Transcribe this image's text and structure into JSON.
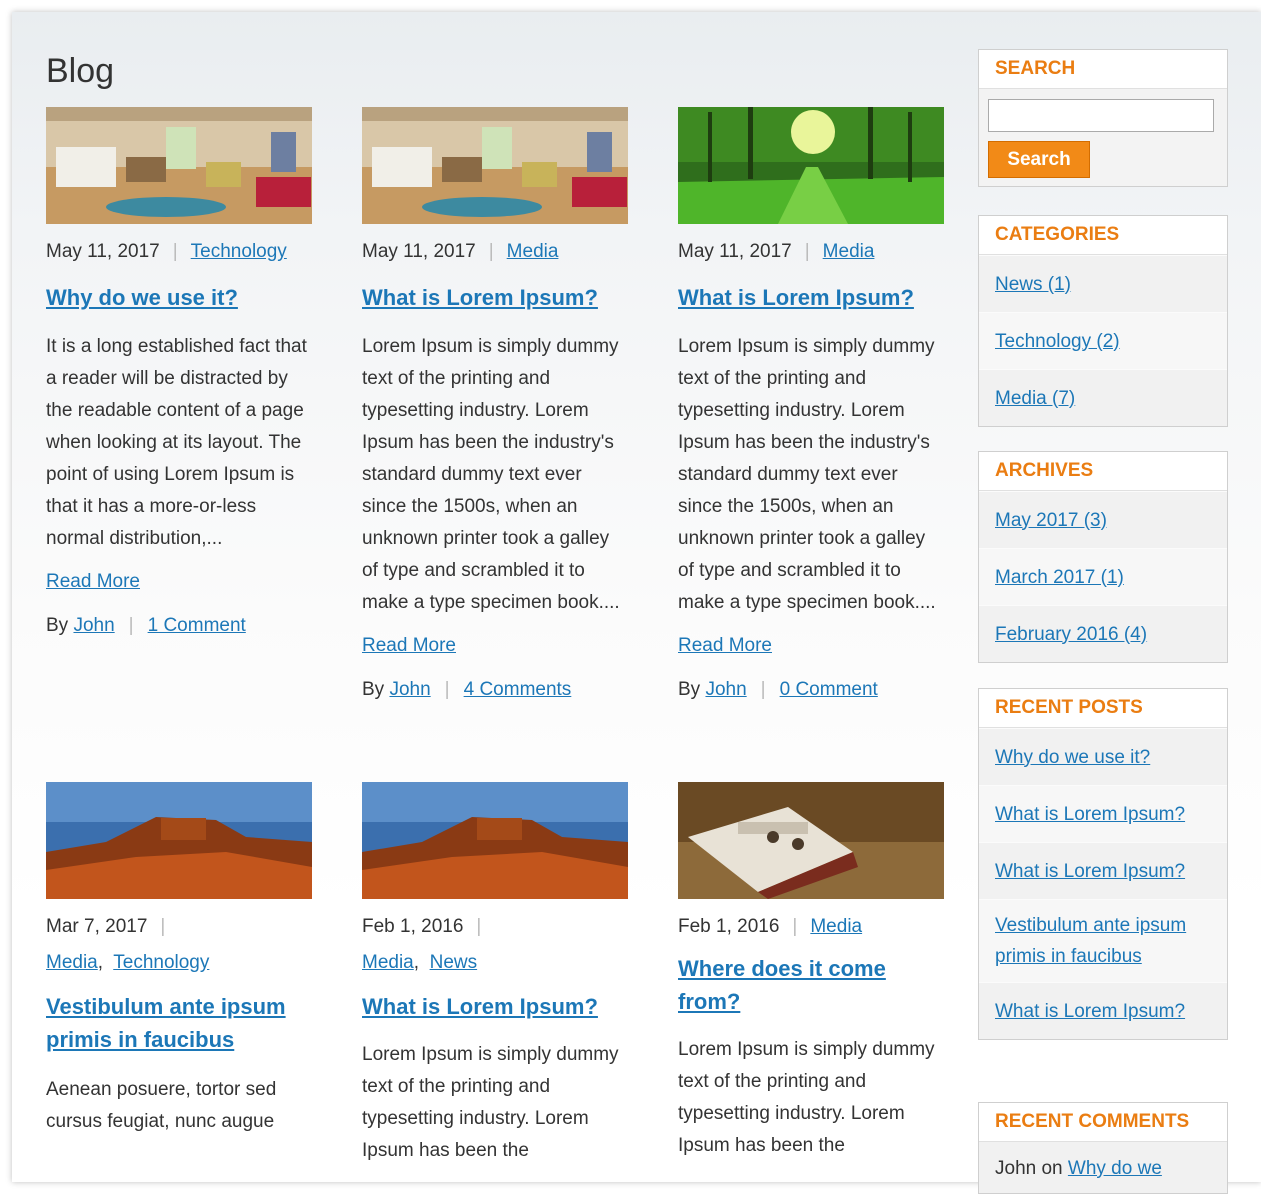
{
  "blog": {
    "title": "Blog",
    "posts": [
      {
        "date": "May 11, 2017",
        "category": "Technology",
        "title": "Why do we use it?",
        "excerpt": "It is a long established fact that a reader will be distracted by the readable content of a page when looking at its layout. The point of using Lorem Ipsum is that it has a more-or-less normal distribution,...",
        "read_more": "Read More",
        "by": "By",
        "author": "John",
        "comments": "1 Comment"
      },
      {
        "date": "May 11, 2017",
        "category": "Media",
        "title": "What is Lorem Ipsum?",
        "excerpt": "Lorem Ipsum is simply dummy text of the printing and typesetting industry. Lorem Ipsum has been the industry's standard dummy text ever since the 1500s, when an unknown printer took a galley of type and scrambled it to make a type specimen book....",
        "read_more": "Read More",
        "by": "By",
        "author": "John",
        "comments": "4 Comments"
      },
      {
        "date": "May 11, 2017",
        "category": "Media",
        "title": "What is Lorem Ipsum?",
        "excerpt": "Lorem Ipsum is simply dummy text of the printing and typesetting industry. Lorem Ipsum has been the industry's standard dummy text ever since the 1500s, when an unknown printer took a galley of type and scrambled it to make a type specimen book....",
        "read_more": "Read More",
        "by": "By",
        "author": "John",
        "comments": "0 Comment"
      },
      {
        "date": "Mar 7, 2017",
        "cat1": "Media",
        "cat2": "Technology",
        "title": "Vestibulum ante ipsum primis in faucibus",
        "excerpt": "Aenean posuere, tortor sed cursus feugiat, nunc augue"
      },
      {
        "date": "Feb 1, 2016",
        "cat1": "Media",
        "cat2": "News",
        "title": "What is Lorem Ipsum?",
        "excerpt": "Lorem Ipsum is simply dummy text of the printing and typesetting industry. Lorem Ipsum has been the"
      },
      {
        "date": "Feb 1, 2016",
        "category": "Media",
        "title": "Where does it come from?",
        "excerpt": "Lorem Ipsum is simply dummy text of the printing and typesetting industry. Lorem Ipsum has been the"
      }
    ]
  },
  "sidebar": {
    "search": {
      "title": "SEARCH",
      "button": "Search"
    },
    "categories": {
      "title": "CATEGORIES",
      "items": [
        "News (1)",
        "Technology (2)",
        "Media (7)"
      ]
    },
    "archives": {
      "title": "ARCHIVES",
      "items": [
        "May 2017 (3)",
        "March 2017 (1)",
        "February 2016 (4)"
      ]
    },
    "recent_posts": {
      "title": "RECENT POSTS",
      "items": [
        "Why do we use it?",
        "What is Lorem Ipsum?",
        "What is Lorem Ipsum?",
        "Vestibulum ante ipsum primis in faucibus",
        "What is Lorem Ipsum?"
      ]
    },
    "recent_comments": {
      "title": "RECENT COMMENTS",
      "author": "John on",
      "link": "Why do we"
    }
  },
  "colors": {
    "accent": "#ea7d12",
    "link": "#1c77b7",
    "button": "#f28a17"
  }
}
